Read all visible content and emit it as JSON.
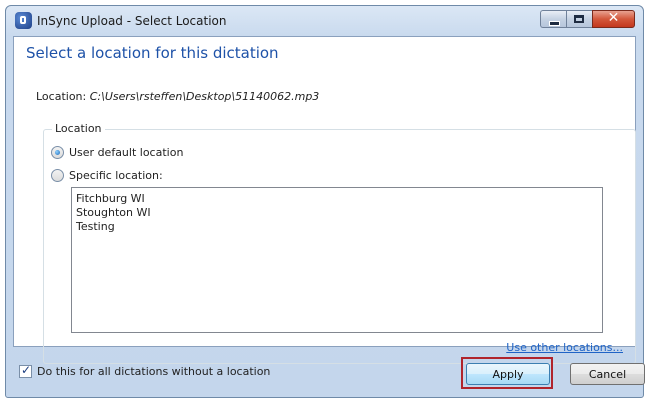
{
  "window": {
    "title": "InSync Upload - Select Location"
  },
  "dialog": {
    "heading": "Select a location for this dictation",
    "location_label": "Location:",
    "location_path": "C:\\Users\\rsteffen\\Desktop\\51140062.mp3"
  },
  "group": {
    "legend": "Location",
    "options": [
      {
        "label": "User default location",
        "checked": true
      },
      {
        "label": "Specific location:",
        "checked": false
      }
    ],
    "locations": [
      "Fitchburg WI",
      "Stoughton WI",
      "Testing"
    ],
    "other_link": "Use other locations..."
  },
  "footer": {
    "checkbox_label": "Do this for all dictations without a location",
    "checkbox_checked": true,
    "apply_label": "Apply",
    "cancel_label": "Cancel"
  },
  "colors": {
    "heading": "#1e52a8",
    "link": "#1f63c6",
    "highlight": "#b0242c"
  }
}
